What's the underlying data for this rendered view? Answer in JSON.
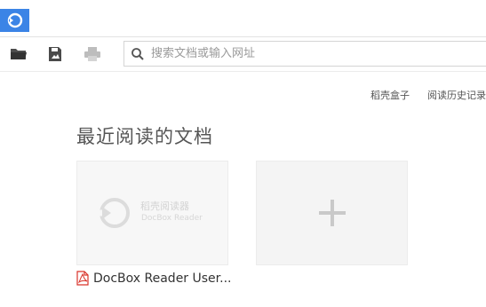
{
  "toolbar": {
    "open_icon": "folder-icon",
    "save_icon": "save-icon",
    "print_icon": "print-icon"
  },
  "search": {
    "placeholder": "搜索文档或输入网址",
    "value": ""
  },
  "links": {
    "box_label": "稻壳盒子",
    "history_label": "阅读历史记录"
  },
  "recent": {
    "title": "最近阅读的文档",
    "documents": [
      {
        "name": "DocBox Reader User...",
        "thumbnail_text": [
          "稻壳阅读器",
          "DocBox Reader"
        ]
      }
    ],
    "add_symbol": "+"
  },
  "colors": {
    "accent": "#3b84e6",
    "pdf_red": "#d9342b"
  }
}
